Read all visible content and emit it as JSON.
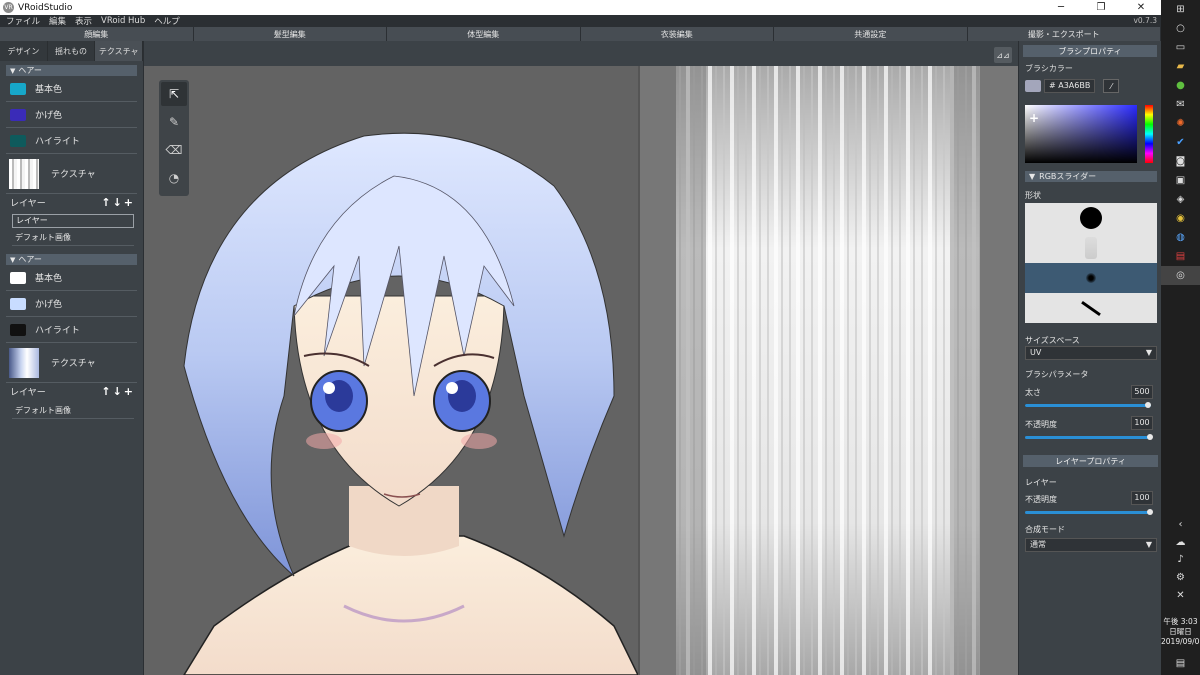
{
  "window": {
    "title": "VRoidStudio",
    "version": "v0.7.3",
    "logo_text": "VR",
    "controls": [
      "─",
      "❐",
      "✕"
    ]
  },
  "menu": [
    "ファイル",
    "編集",
    "表示",
    "VRoid Hub",
    "ヘルプ"
  ],
  "tabs": [
    "顔編集",
    "髪型編集",
    "体型編集",
    "衣装編集",
    "共通設定",
    "撮影・エクスポート"
  ],
  "left_panel": {
    "subtabs": [
      "デザイン",
      "揺れもの",
      "テクスチャ"
    ],
    "sections": [
      {
        "title": "ヘアー",
        "colors": [
          {
            "label": "基本色",
            "color": "#17a7c9"
          },
          {
            "label": "かげ色",
            "color": "#3a2bb8"
          },
          {
            "label": "ハイライト",
            "color": "#0e5a5c"
          }
        ],
        "texture_label": "テクスチャ",
        "layer_label": "レイヤー",
        "layer_input": "レイヤー",
        "layer_item": "デフォルト画像"
      },
      {
        "title": "ヘアー",
        "colors": [
          {
            "label": "基本色",
            "color": "#ffffff"
          },
          {
            "label": "かげ色",
            "color": "#c8dcff"
          },
          {
            "label": "ハイライト",
            "color": "#111111"
          }
        ],
        "texture_label": "テクスチャ",
        "layer_label": "レイヤー",
        "layer_item": "デフォルト画像"
      }
    ]
  },
  "right_panel": {
    "brush_title": "ブラシプロパティ",
    "brush_color_label": "ブラシカラー",
    "brush_color_hex": "# A3A6BB",
    "brush_color": "#a3a6bb",
    "rgb_slider_label": "RGBスライダー",
    "shape_label": "形状",
    "size_space_label": "サイズスペース",
    "size_space_value": "UV",
    "brush_param_label": "ブラシパラメータ",
    "thickness_label": "太さ",
    "thickness_value": "500",
    "opacity_label": "不透明度",
    "opacity_value": "100",
    "layer_title": "レイヤープロパティ",
    "layer_label": "レイヤー",
    "layer_opacity_label": "不透明度",
    "layer_opacity_value": "100",
    "blend_label": "合成モード",
    "blend_value": "通常"
  },
  "taskbar": {
    "time": "午後 3:03",
    "day": "日曜日",
    "date": "2019/09/01"
  }
}
